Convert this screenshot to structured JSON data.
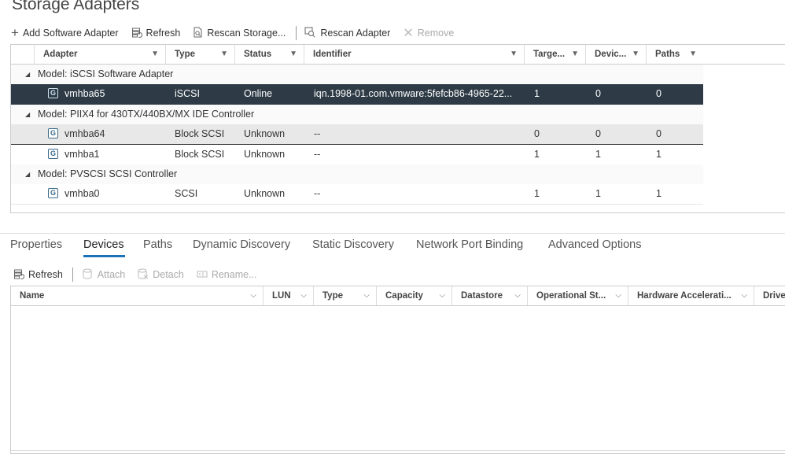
{
  "page_title": "Storage Adapters",
  "toolbar": {
    "add_software_adapter": "Add Software Adapter",
    "refresh": "Refresh",
    "rescan_storage": "Rescan Storage...",
    "rescan_adapter": "Rescan Adapter",
    "remove": "Remove"
  },
  "adapters_table": {
    "columns": {
      "adapter": "Adapter",
      "type": "Type",
      "status": "Status",
      "identifier": "Identifier",
      "targets": "Targe...",
      "devices": "Devic...",
      "paths": "Paths"
    },
    "groups": [
      {
        "label": "Model: iSCSI Software Adapter",
        "rows": [
          {
            "adapter": "vmhba65",
            "type": "iSCSI",
            "status": "Online",
            "identifier": "iqn.1998-01.com.vmware:5fefcb86-4965-22...",
            "targets": "1",
            "devices": "0",
            "paths": "0"
          }
        ]
      },
      {
        "label": "Model: PIIX4 for 430TX/440BX/MX IDE Controller",
        "rows": [
          {
            "adapter": "vmhba64",
            "type": "Block SCSI",
            "status": "Unknown",
            "identifier": "--",
            "targets": "0",
            "devices": "0",
            "paths": "0"
          },
          {
            "adapter": "vmhba1",
            "type": "Block SCSI",
            "status": "Unknown",
            "identifier": "--",
            "targets": "1",
            "devices": "1",
            "paths": "1"
          }
        ]
      },
      {
        "label": "Model: PVSCSI SCSI Controller",
        "rows": [
          {
            "adapter": "vmhba0",
            "type": "SCSI",
            "status": "Unknown",
            "identifier": "--",
            "targets": "1",
            "devices": "1",
            "paths": "1"
          }
        ]
      }
    ]
  },
  "tabs": [
    {
      "label": "Properties"
    },
    {
      "label": "Devices"
    },
    {
      "label": "Paths"
    },
    {
      "label": "Dynamic Discovery"
    },
    {
      "label": "Static Discovery"
    },
    {
      "label": "Network Port Binding"
    },
    {
      "label": "Advanced Options"
    }
  ],
  "active_tab": "Devices",
  "devices_toolbar": {
    "refresh": "Refresh",
    "attach": "Attach",
    "detach": "Detach",
    "rename": "Rename..."
  },
  "devices_table": {
    "columns": {
      "name": "Name",
      "lun": "LUN",
      "type": "Type",
      "capacity": "Capacity",
      "datastore": "Datastore",
      "operational_state": "Operational St...",
      "hardware_acceleration": "Hardware Accelerati...",
      "drive": "Drive"
    }
  },
  "colors": {
    "selected_row": "#2e3b46",
    "tab_accent": "#1a73b8"
  }
}
